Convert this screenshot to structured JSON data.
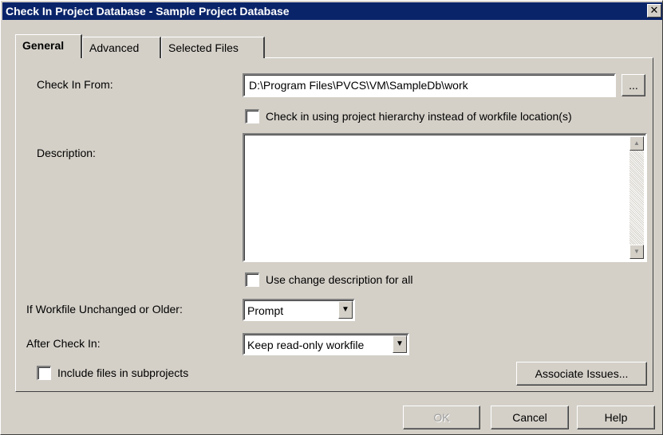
{
  "window": {
    "title": "Check In Project Database - Sample Project Database",
    "close_glyph": "✕"
  },
  "tabs": [
    {
      "label": "General",
      "active": true
    },
    {
      "label": "Advanced",
      "active": false
    },
    {
      "label": "Selected Files",
      "active": false
    }
  ],
  "general": {
    "check_in_from_label": "Check In From:",
    "check_in_from_value": "D:\\Program Files\\PVCS\\VM\\SampleDb\\work",
    "browse_label": "...",
    "hierarchy_checkbox_label": "Check in using project hierarchy instead of workfile location(s)",
    "hierarchy_checked": false,
    "description_label": "Description:",
    "description_value": "",
    "use_change_description_label": "Use change description for all",
    "use_change_description_checked": false,
    "if_unchanged_label": "If Workfile Unchanged or Older:",
    "if_unchanged_value": "Prompt",
    "after_check_in_label": "After Check In:",
    "after_check_in_value": "Keep read-only workfile",
    "include_subprojects_label": "Include files in subprojects",
    "include_subprojects_checked": false,
    "associate_issues_label": "Associate Issues..."
  },
  "footer": {
    "ok_label": "OK",
    "ok_disabled": true,
    "cancel_label": "Cancel",
    "help_label": "Help"
  },
  "icons": {
    "dropdown_arrow": "▼",
    "scroll_up": "▲",
    "scroll_down": "▼"
  },
  "colors": {
    "titlebar": "#0a246a",
    "face": "#d4d0c8"
  }
}
